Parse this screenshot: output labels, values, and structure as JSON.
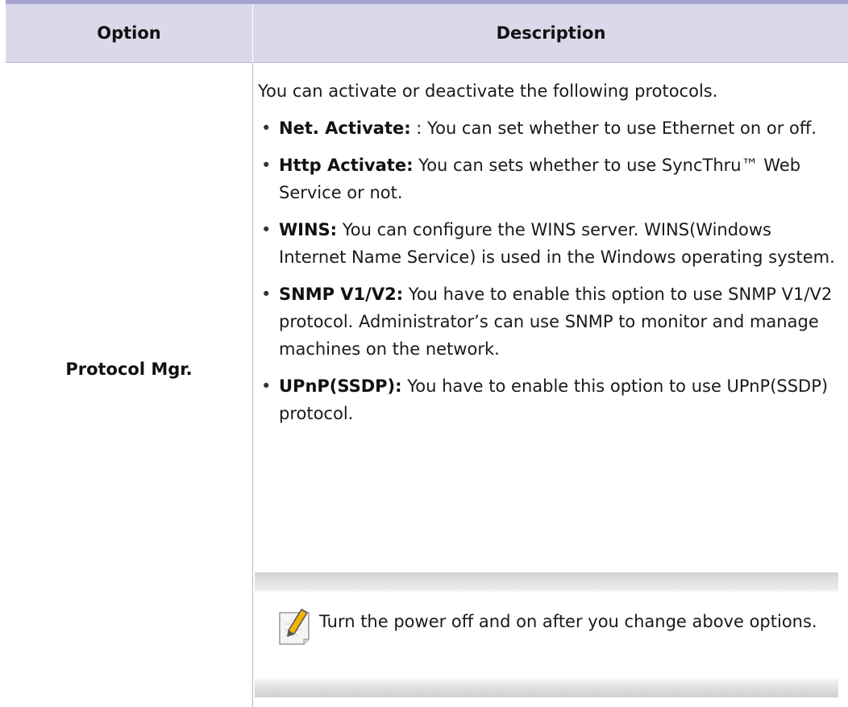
{
  "table": {
    "headers": {
      "option": "Option",
      "description": "Description"
    },
    "row": {
      "option": "Protocol Mgr.",
      "intro": "You can activate or deactivate the following protocols.",
      "items": [
        {
          "term": "Net. Activate:",
          "text": " : You can set whether to use Ethernet on or off."
        },
        {
          "term": "Http Activate:",
          "text": "  You can sets whether to use SyncThru™ Web Service or not."
        },
        {
          "term": "WINS:",
          "text": "  You can configure the WINS server. WINS(Windows Internet Name Service) is used in the Windows operating system."
        },
        {
          "term": "SNMP V1/V2:",
          "text": " You have to enable this option to use SNMP V1/V2 protocol. Administrator’s can use SNMP to monitor and manage machines on the network."
        },
        {
          "term": "UPnP(SSDP):",
          "text": " You have to enable this option to use UPnP(SSDP) protocol."
        }
      ],
      "note": {
        "icon": "note-pencil-icon",
        "text": "Turn the power off and on after you change above options."
      }
    }
  },
  "colors": {
    "header_bg": "#d9d9ea",
    "top_rule": "#a6a3cf",
    "divider": "#b9b7d8",
    "icon_accent": "#f5b400"
  }
}
